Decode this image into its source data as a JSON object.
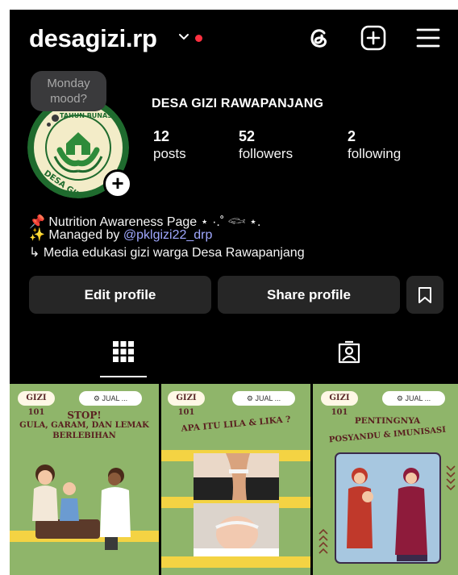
{
  "header": {
    "username": "desagizi.rp",
    "icons": [
      "threads-icon",
      "plus-square-icon",
      "menu-icon"
    ]
  },
  "note": {
    "text_line1": "Monday",
    "text_line2": "mood?"
  },
  "profile": {
    "display_name": "DESA GIZI RAWAPANJANG",
    "avatar_text_top": "TAHUN BUNAS",
    "avatar_text_bottom": "DESA GIZI RAWA PANJANG",
    "stats": [
      {
        "value": "12",
        "label": "posts"
      },
      {
        "value": "52",
        "label": "followers"
      },
      {
        "value": "2",
        "label": "following"
      }
    ]
  },
  "bio": {
    "line1_prefix": "📌",
    "line1_text": "Nutrition Awareness Page",
    "line1_suffix": "⋆ ·.˚ 𓆟 ⋆.",
    "line2_prefix": "✨ Managed by ",
    "line2_link": "@pklgizi22_drp",
    "line3": "↳ Media edukasi gizi warga Desa Rawapanjang"
  },
  "actions": {
    "edit_label": "Edit profile",
    "share_label": "Share profile"
  },
  "tabs": [
    "grid-icon",
    "tagged-icon"
  ],
  "posts": [
    {
      "tag": "GIZI 101",
      "logo": "⚙ JUAL ...",
      "title_1": "STOP!",
      "title_2": "GULA, GARAM, DAN LEMAK",
      "title_3": "BERLEBIHAN"
    },
    {
      "tag": "GIZI 101",
      "logo": "⚙ JUAL ...",
      "title_1": "APA ITU LILA & LIKA ?"
    },
    {
      "tag": "GIZI 101",
      "logo": "⚙ JUAL ...",
      "title_1": "PENTINGNYA",
      "title_2": "POSYANDU & IMUNISASI"
    }
  ],
  "colors": {
    "background": "#000000",
    "button": "#262626",
    "accent_link": "#a0a8ff",
    "notification": "#ff3040",
    "post_green": "#8fb56a",
    "post_yellow": "#f4d343"
  }
}
